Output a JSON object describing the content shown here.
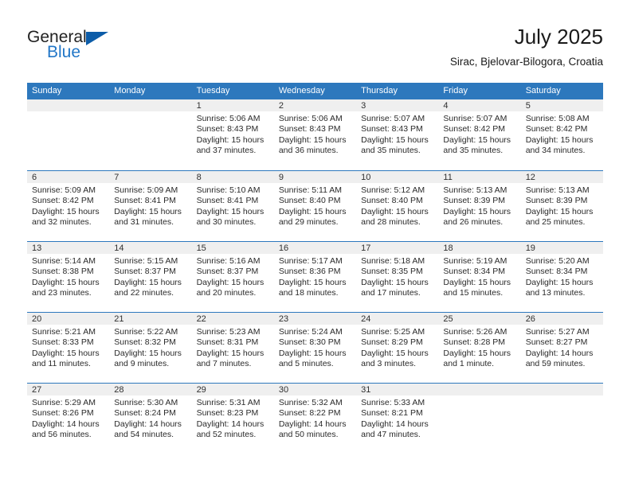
{
  "brand": {
    "name_top": "General",
    "name_bottom": "Blue"
  },
  "header": {
    "title": "July 2025",
    "subtitle": "Sirac, Bjelovar-Bilogora, Croatia"
  },
  "colors": {
    "header_blue": "#2d78bd",
    "daynum_band": "#efefef",
    "brand_blue": "#2176c7",
    "triangle_blue": "#0c5ca8",
    "text": "#2a2a2a"
  },
  "weekdays": [
    "Sunday",
    "Monday",
    "Tuesday",
    "Wednesday",
    "Thursday",
    "Friday",
    "Saturday"
  ],
  "weeks": [
    [
      {
        "day": "",
        "lines": []
      },
      {
        "day": "",
        "lines": []
      },
      {
        "day": "1",
        "lines": [
          "Sunrise: 5:06 AM",
          "Sunset: 8:43 PM",
          "Daylight: 15 hours",
          "and 37 minutes."
        ]
      },
      {
        "day": "2",
        "lines": [
          "Sunrise: 5:06 AM",
          "Sunset: 8:43 PM",
          "Daylight: 15 hours",
          "and 36 minutes."
        ]
      },
      {
        "day": "3",
        "lines": [
          "Sunrise: 5:07 AM",
          "Sunset: 8:43 PM",
          "Daylight: 15 hours",
          "and 35 minutes."
        ]
      },
      {
        "day": "4",
        "lines": [
          "Sunrise: 5:07 AM",
          "Sunset: 8:42 PM",
          "Daylight: 15 hours",
          "and 35 minutes."
        ]
      },
      {
        "day": "5",
        "lines": [
          "Sunrise: 5:08 AM",
          "Sunset: 8:42 PM",
          "Daylight: 15 hours",
          "and 34 minutes."
        ]
      }
    ],
    [
      {
        "day": "6",
        "lines": [
          "Sunrise: 5:09 AM",
          "Sunset: 8:42 PM",
          "Daylight: 15 hours",
          "and 32 minutes."
        ]
      },
      {
        "day": "7",
        "lines": [
          "Sunrise: 5:09 AM",
          "Sunset: 8:41 PM",
          "Daylight: 15 hours",
          "and 31 minutes."
        ]
      },
      {
        "day": "8",
        "lines": [
          "Sunrise: 5:10 AM",
          "Sunset: 8:41 PM",
          "Daylight: 15 hours",
          "and 30 minutes."
        ]
      },
      {
        "day": "9",
        "lines": [
          "Sunrise: 5:11 AM",
          "Sunset: 8:40 PM",
          "Daylight: 15 hours",
          "and 29 minutes."
        ]
      },
      {
        "day": "10",
        "lines": [
          "Sunrise: 5:12 AM",
          "Sunset: 8:40 PM",
          "Daylight: 15 hours",
          "and 28 minutes."
        ]
      },
      {
        "day": "11",
        "lines": [
          "Sunrise: 5:13 AM",
          "Sunset: 8:39 PM",
          "Daylight: 15 hours",
          "and 26 minutes."
        ]
      },
      {
        "day": "12",
        "lines": [
          "Sunrise: 5:13 AM",
          "Sunset: 8:39 PM",
          "Daylight: 15 hours",
          "and 25 minutes."
        ]
      }
    ],
    [
      {
        "day": "13",
        "lines": [
          "Sunrise: 5:14 AM",
          "Sunset: 8:38 PM",
          "Daylight: 15 hours",
          "and 23 minutes."
        ]
      },
      {
        "day": "14",
        "lines": [
          "Sunrise: 5:15 AM",
          "Sunset: 8:37 PM",
          "Daylight: 15 hours",
          "and 22 minutes."
        ]
      },
      {
        "day": "15",
        "lines": [
          "Sunrise: 5:16 AM",
          "Sunset: 8:37 PM",
          "Daylight: 15 hours",
          "and 20 minutes."
        ]
      },
      {
        "day": "16",
        "lines": [
          "Sunrise: 5:17 AM",
          "Sunset: 8:36 PM",
          "Daylight: 15 hours",
          "and 18 minutes."
        ]
      },
      {
        "day": "17",
        "lines": [
          "Sunrise: 5:18 AM",
          "Sunset: 8:35 PM",
          "Daylight: 15 hours",
          "and 17 minutes."
        ]
      },
      {
        "day": "18",
        "lines": [
          "Sunrise: 5:19 AM",
          "Sunset: 8:34 PM",
          "Daylight: 15 hours",
          "and 15 minutes."
        ]
      },
      {
        "day": "19",
        "lines": [
          "Sunrise: 5:20 AM",
          "Sunset: 8:34 PM",
          "Daylight: 15 hours",
          "and 13 minutes."
        ]
      }
    ],
    [
      {
        "day": "20",
        "lines": [
          "Sunrise: 5:21 AM",
          "Sunset: 8:33 PM",
          "Daylight: 15 hours",
          "and 11 minutes."
        ]
      },
      {
        "day": "21",
        "lines": [
          "Sunrise: 5:22 AM",
          "Sunset: 8:32 PM",
          "Daylight: 15 hours",
          "and 9 minutes."
        ]
      },
      {
        "day": "22",
        "lines": [
          "Sunrise: 5:23 AM",
          "Sunset: 8:31 PM",
          "Daylight: 15 hours",
          "and 7 minutes."
        ]
      },
      {
        "day": "23",
        "lines": [
          "Sunrise: 5:24 AM",
          "Sunset: 8:30 PM",
          "Daylight: 15 hours",
          "and 5 minutes."
        ]
      },
      {
        "day": "24",
        "lines": [
          "Sunrise: 5:25 AM",
          "Sunset: 8:29 PM",
          "Daylight: 15 hours",
          "and 3 minutes."
        ]
      },
      {
        "day": "25",
        "lines": [
          "Sunrise: 5:26 AM",
          "Sunset: 8:28 PM",
          "Daylight: 15 hours",
          "and 1 minute."
        ]
      },
      {
        "day": "26",
        "lines": [
          "Sunrise: 5:27 AM",
          "Sunset: 8:27 PM",
          "Daylight: 14 hours",
          "and 59 minutes."
        ]
      }
    ],
    [
      {
        "day": "27",
        "lines": [
          "Sunrise: 5:29 AM",
          "Sunset: 8:26 PM",
          "Daylight: 14 hours",
          "and 56 minutes."
        ]
      },
      {
        "day": "28",
        "lines": [
          "Sunrise: 5:30 AM",
          "Sunset: 8:24 PM",
          "Daylight: 14 hours",
          "and 54 minutes."
        ]
      },
      {
        "day": "29",
        "lines": [
          "Sunrise: 5:31 AM",
          "Sunset: 8:23 PM",
          "Daylight: 14 hours",
          "and 52 minutes."
        ]
      },
      {
        "day": "30",
        "lines": [
          "Sunrise: 5:32 AM",
          "Sunset: 8:22 PM",
          "Daylight: 14 hours",
          "and 50 minutes."
        ]
      },
      {
        "day": "31",
        "lines": [
          "Sunrise: 5:33 AM",
          "Sunset: 8:21 PM",
          "Daylight: 14 hours",
          "and 47 minutes."
        ]
      },
      {
        "day": "",
        "lines": []
      },
      {
        "day": "",
        "lines": []
      }
    ]
  ]
}
